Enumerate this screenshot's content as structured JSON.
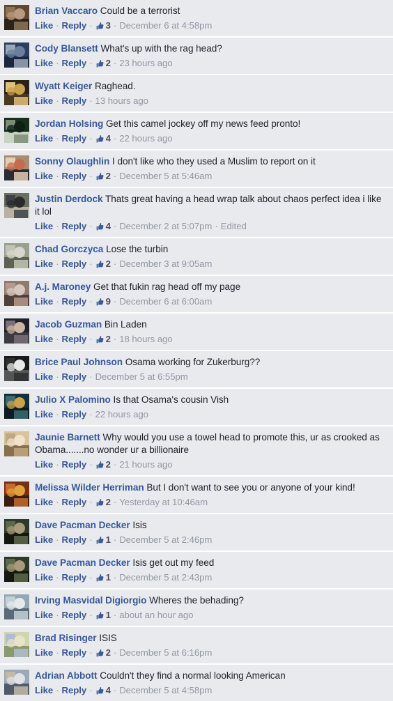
{
  "theme": {
    "row_background": "#e9eaed",
    "separator": "#ffffff",
    "author_link": "#365899",
    "comment_text": "#1d2129",
    "meta_muted": "#9197a3",
    "like_count": "#4b4f56",
    "thumb_icon_blue": "#3b5998"
  },
  "labels": {
    "like": "Like",
    "reply": "Reply",
    "separator_dot": "·",
    "edited": "Edited",
    "thumb_icon_name": "thumbs-up-icon"
  },
  "comments": [
    {
      "author": "Brian Vaccaro",
      "text": "Could be a terrorist",
      "likes": "3",
      "timestamp": "December 6 at 4:58pm",
      "edited": false,
      "avatar_name": "avatar-brian-vaccaro",
      "avatar_colors": [
        "#5e4733",
        "#b99a7c",
        "#2e2318",
        "#8d7456"
      ]
    },
    {
      "author": "Cody Blansett",
      "text": "What's up with the rag head?",
      "likes": "2",
      "timestamp": "23 hours ago",
      "edited": false,
      "avatar_name": "avatar-cody-blansett",
      "avatar_colors": [
        "#2b3f63",
        "#6a7f9c",
        "#1b2740",
        "#9aa7b8"
      ]
    },
    {
      "author": "Wyatt Keiger",
      "text": "Raghead.",
      "likes": null,
      "timestamp": "13 hours ago",
      "edited": false,
      "avatar_name": "avatar-wyatt-keiger",
      "avatar_colors": [
        "#2a2218",
        "#c9a24a",
        "#4a3a22",
        "#e0c07a"
      ]
    },
    {
      "author": "Jordan Holsing",
      "text": "Get this camel jockey off my news feed pronto!",
      "likes": "4",
      "timestamp": "22 hours ago",
      "edited": false,
      "avatar_name": "avatar-jordan-holsing",
      "avatar_colors": [
        "#16301c",
        "#0d1f12",
        "#c8d3c2",
        "#7d8c76"
      ]
    },
    {
      "author": "Sonny Olaughlin",
      "text": "I don't like who they used a Muslim to report on it",
      "likes": "2",
      "timestamp": "December 5 at 5:46am",
      "edited": false,
      "avatar_name": "avatar-sonny-olaughlin",
      "avatar_colors": [
        "#a88d72",
        "#c76b4e",
        "#2c2a33",
        "#e3cdb4"
      ]
    },
    {
      "author": "Justin Derdock",
      "text": "Thats great having a head wrap talk about chaos perfect idea i like it lol",
      "likes": "4",
      "timestamp": "December 2 at 5:07pm",
      "edited": true,
      "avatar_name": "avatar-justin-derdock",
      "avatar_colors": [
        "#6b6f63",
        "#2b2b2b",
        "#b9b2a2",
        "#3d4347"
      ]
    },
    {
      "author": "Chad Gorczyca",
      "text": "Lose the turbin",
      "likes": "2",
      "timestamp": "December 3 at 9:05am",
      "edited": false,
      "avatar_name": "avatar-chad-gorczyca",
      "avatar_colors": [
        "#9aa08e",
        "#d7d5cc",
        "#5d6352",
        "#bfc4b4"
      ]
    },
    {
      "author": "A.j. Maroney",
      "text": "Get that fukin rag head off my page",
      "likes": "9",
      "timestamp": "December 6 at 6:00am",
      "edited": false,
      "avatar_name": "avatar-aj-maroney",
      "avatar_colors": [
        "#8f7a6e",
        "#d6c7bd",
        "#50403a",
        "#b59a8c"
      ]
    },
    {
      "author": "Jacob Guzman",
      "text": "Bin Laden",
      "likes": "2",
      "timestamp": "18 hours ago",
      "edited": false,
      "avatar_name": "avatar-jacob-guzman",
      "avatar_colors": [
        "#1f1f25",
        "#cbb6a4",
        "#3c3a42",
        "#7a7078"
      ]
    },
    {
      "author": "Brice Paul Johnson",
      "text": "Osama working for Zukerburg??",
      "likes": null,
      "timestamp": "December 5 at 6:55pm",
      "edited": false,
      "avatar_name": "avatar-brice-paul-johnson",
      "avatar_colors": [
        "#1a1a1a",
        "#e8e8e8",
        "#555555",
        "#2f2f2f"
      ]
    },
    {
      "author": "Julio X Palomino",
      "text": "Is that Osama's cousin Vish",
      "likes": null,
      "timestamp": "22 hours ago",
      "edited": false,
      "avatar_name": "avatar-julio-x-palomino",
      "avatar_colors": [
        "#12323a",
        "#c9a24a",
        "#0b1c22",
        "#3b6c72"
      ]
    },
    {
      "author": "Jaunie Barnett",
      "text": "Why would you use a towel head to promote this, ur as crooked as Obama.......no wonder ur a billionaire",
      "likes": "2",
      "timestamp": "21 hours ago",
      "edited": false,
      "avatar_name": "avatar-jaunie-barnett",
      "avatar_colors": [
        "#d8c39a",
        "#f0e2cc",
        "#8a6f4e",
        "#bfa77f"
      ]
    },
    {
      "author": "Melissa Wilder Herriman",
      "text": "But I don't want to see you or anyone of your kind!",
      "likes": "2",
      "timestamp": "Yesterday at 10:46am",
      "edited": false,
      "avatar_name": "avatar-melissa-wilder-herriman",
      "avatar_colors": [
        "#7a2e14",
        "#e0a23a",
        "#3a1d10",
        "#c86a2a"
      ]
    },
    {
      "author": "Dave Pacman Decker",
      "text": "Isis",
      "likes": "1",
      "timestamp": "December 5 at 2:46pm",
      "edited": false,
      "avatar_name": "avatar-dave-pacman-decker-1",
      "avatar_colors": [
        "#2d3a2a",
        "#a89a7c",
        "#14180f",
        "#5d6a4a"
      ]
    },
    {
      "author": "Dave Pacman Decker",
      "text": "Isis get out my feed",
      "likes": "1",
      "timestamp": "December 5 at 2:43pm",
      "edited": false,
      "avatar_name": "avatar-dave-pacman-decker-2",
      "avatar_colors": [
        "#2d3a2a",
        "#a89a7c",
        "#14180f",
        "#5d6a4a"
      ]
    },
    {
      "author": "Irving Masvidal Digiorgio",
      "text": "Wheres the behading?",
      "likes": "1",
      "timestamp": "about an hour ago",
      "edited": false,
      "avatar_name": "avatar-irving-masvidal-digiorgio",
      "avatar_colors": [
        "#93a7b5",
        "#e6e9ec",
        "#5a6b78",
        "#c4cfd6"
      ]
    },
    {
      "author": "Brad Risinger",
      "text": "ISIS",
      "likes": "2",
      "timestamp": "December 5 at 6:16pm",
      "edited": false,
      "avatar_name": "avatar-brad-risinger",
      "avatar_colors": [
        "#cfd6b0",
        "#e8e4c8",
        "#8a9a6c",
        "#b0bcd0"
      ]
    },
    {
      "author": "Adrian Abbott",
      "text": "Couldn't they find a normal looking American",
      "likes": "4",
      "timestamp": "December 5 at 4:58pm",
      "edited": false,
      "avatar_name": "avatar-adrian-abbott",
      "avatar_colors": [
        "#9aa8b8",
        "#dfe3e8",
        "#4f5b68",
        "#c2b9a8"
      ]
    }
  ]
}
